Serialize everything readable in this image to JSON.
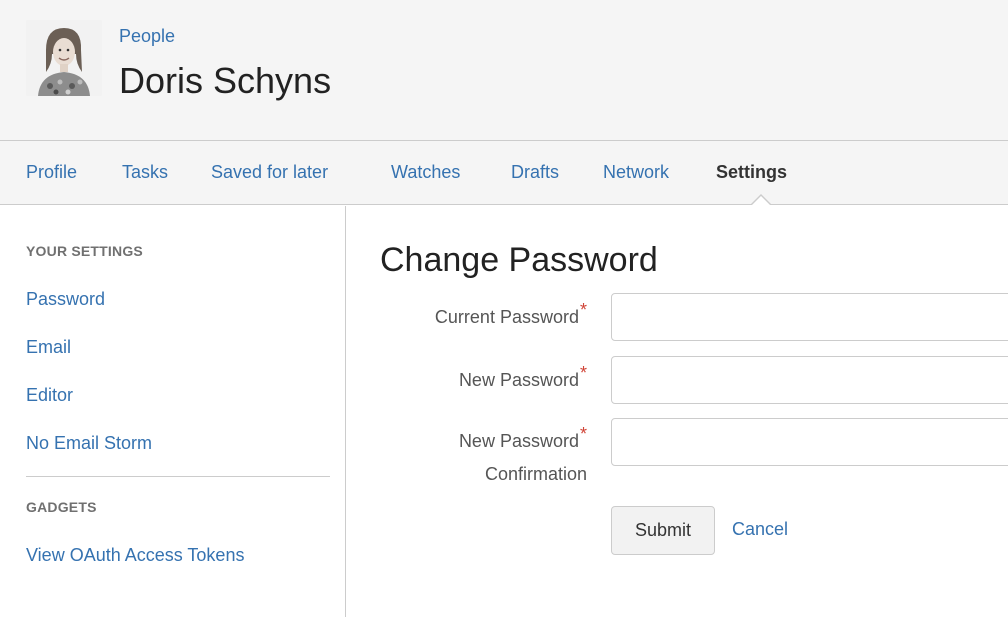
{
  "header": {
    "breadcrumb": "People",
    "title": "Doris Schyns"
  },
  "nav": {
    "tabs": [
      {
        "label": "Profile",
        "active": false
      },
      {
        "label": "Tasks",
        "active": false
      },
      {
        "label": "Saved for later",
        "active": false
      },
      {
        "label": "Watches",
        "active": false
      },
      {
        "label": "Drafts",
        "active": false
      },
      {
        "label": "Network",
        "active": false
      },
      {
        "label": "Settings",
        "active": true
      }
    ]
  },
  "sidebar": {
    "settings_heading": "YOUR SETTINGS",
    "settings_items": [
      "Password",
      "Email",
      "Editor",
      "No Email Storm"
    ],
    "gadgets_heading": "GADGETS",
    "gadgets_items": [
      "View OAuth Access Tokens"
    ]
  },
  "form": {
    "title": "Change Password",
    "current_password_label": "Current Password",
    "new_password_label": "New Password",
    "confirm_label_line1": "New Password",
    "confirm_label_line2": "Confirmation",
    "required_marker": "*",
    "current_password_value": "",
    "new_password_value": "",
    "confirm_value": "",
    "submit_label": "Submit",
    "cancel_label": "Cancel"
  },
  "colors": {
    "link": "#3572b0",
    "required": "#d04437",
    "header_bg": "#f5f5f5"
  }
}
